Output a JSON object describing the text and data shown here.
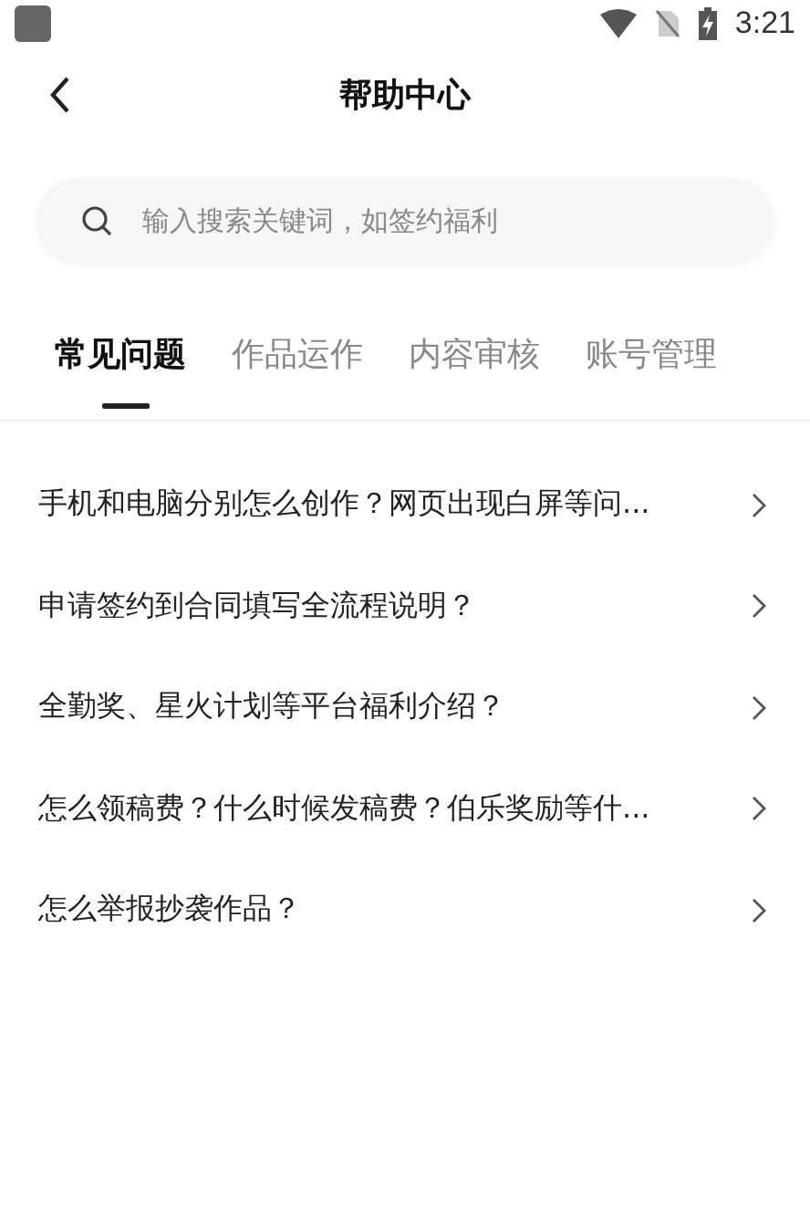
{
  "status_bar": {
    "time": "3:21"
  },
  "header": {
    "title": "帮助中心"
  },
  "search": {
    "placeholder": "输入搜索关键词，如签约福利"
  },
  "tabs": [
    {
      "label": "常见问题",
      "selected": true
    },
    {
      "label": "作品运作",
      "selected": false
    },
    {
      "label": "内容审核",
      "selected": false
    },
    {
      "label": "账号管理",
      "selected": false
    }
  ],
  "questions": [
    {
      "text": "手机和电脑分别怎么创作？网页出现白屏等问..."
    },
    {
      "text": "申请签约到合同填写全流程说明？"
    },
    {
      "text": "全勤奖、星火计划等平台福利介绍？"
    },
    {
      "text": "怎么领稿费？什么时候发稿费？伯乐奖励等什..."
    },
    {
      "text": "怎么举报抄袭作品？"
    }
  ]
}
